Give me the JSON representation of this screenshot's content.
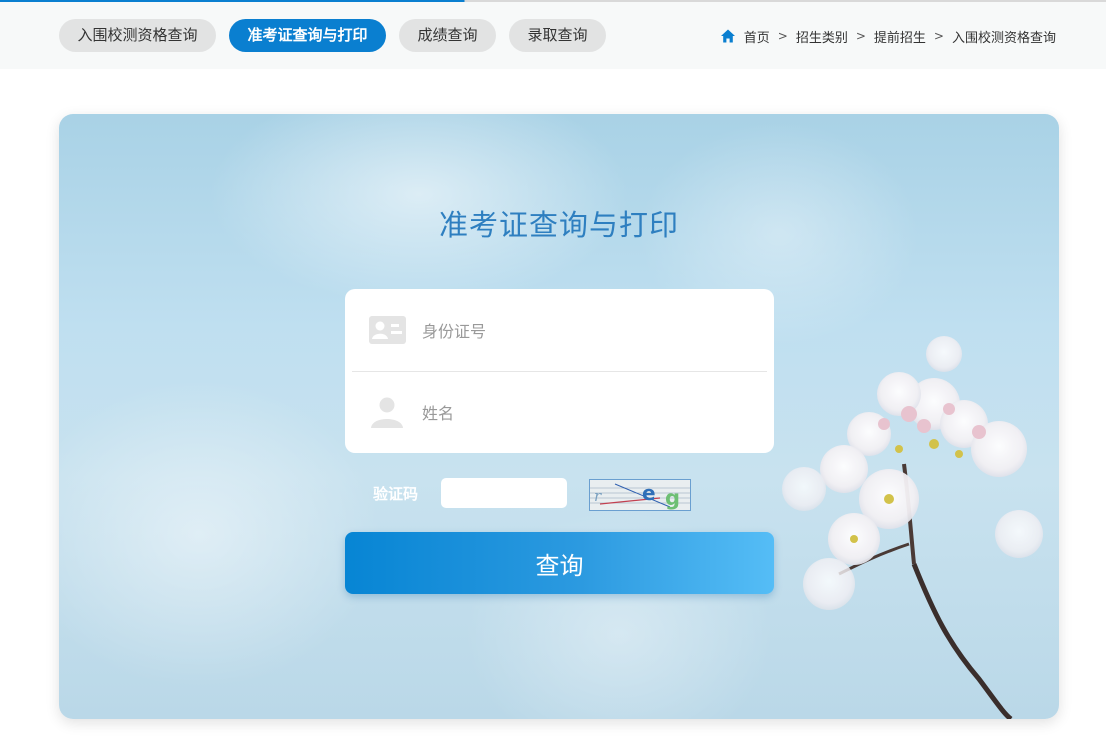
{
  "nav": {
    "tabs": [
      {
        "label": "入围校测资格查询"
      },
      {
        "label": "准考证查询与打印",
        "active": true
      },
      {
        "label": "成绩查询"
      },
      {
        "label": "录取查询"
      }
    ]
  },
  "breadcrumb": {
    "items": [
      "首页",
      "招生类别",
      "提前招生",
      "入围校测资格查询"
    ],
    "separator": ">"
  },
  "form": {
    "title": "准考证查询与打印",
    "id_field": {
      "placeholder": "身份证号",
      "value": ""
    },
    "name_field": {
      "placeholder": "姓名",
      "value": ""
    },
    "captcha": {
      "label": "验证码",
      "value": "",
      "image_text": "r eg"
    },
    "submit_label": "查询"
  },
  "colors": {
    "accent": "#0a7fd0",
    "title": "#2e7fc0",
    "tab_inactive": "#e2e3e3"
  }
}
